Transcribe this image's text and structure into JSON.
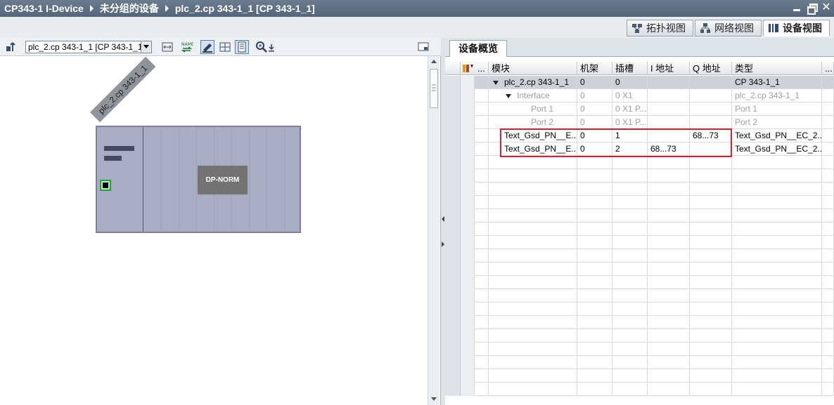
{
  "titlebar": {
    "crumbs": [
      "CP343-1 I-Device",
      "未分组的设备",
      "plc_2.cp 343-1_1 [CP 343-1_1]"
    ]
  },
  "viewtabs": [
    {
      "label": "拓扑视图",
      "icon": "topology-icon"
    },
    {
      "label": "网络视图",
      "icon": "network-icon"
    },
    {
      "label": "设备视图",
      "icon": "device-icon",
      "active": true
    }
  ],
  "toolbar": {
    "device_select": "plc_2.cp 343-1_1 [CP 343-1_1]"
  },
  "canvas": {
    "rail_label": "plc_2.cp 343-1_1",
    "module_label": "DP-NORM"
  },
  "overview": {
    "tab_label": "设备概览",
    "columns": [
      "...",
      "模块",
      "机架",
      "插槽",
      "I 地址",
      "Q 地址",
      "类型",
      "..."
    ],
    "rows": [
      {
        "module": "plc_2.cp 343-1_1",
        "rack": "0",
        "slot": "0",
        "i_addr": "",
        "q_addr": "",
        "type": "CP 343-1_1",
        "gray": false,
        "expand": true,
        "indent": 0
      },
      {
        "module": "Interface",
        "rack": "0",
        "slot": "0 X1",
        "i_addr": "",
        "q_addr": "",
        "type": "plc_2.cp 343-1_1",
        "gray": true,
        "expand": true,
        "indent": 1
      },
      {
        "module": "Port 1",
        "rack": "0",
        "slot": "0 X1 P...",
        "i_addr": "",
        "q_addr": "",
        "type": "Port 1",
        "gray": true,
        "expand": false,
        "indent": 2
      },
      {
        "module": "Port 2",
        "rack": "0",
        "slot": "0 X1 P...",
        "i_addr": "",
        "q_addr": "",
        "type": "Port 2",
        "gray": true,
        "expand": false,
        "indent": 2
      },
      {
        "module": "Text_Gsd_PN__E...",
        "rack": "0",
        "slot": "1",
        "i_addr": "",
        "q_addr": "68...73",
        "type": "Text_Gsd_PN__EC_2...",
        "gray": false,
        "expand": false,
        "indent": 0
      },
      {
        "module": "Text_Gsd_PN__E...",
        "rack": "0",
        "slot": "2",
        "i_addr": "68...73",
        "q_addr": "",
        "type": "Text_Gsd_PN__EC_2...",
        "gray": false,
        "expand": false,
        "indent": 0
      }
    ]
  },
  "colors": {
    "titlebar": "#5f6f80",
    "highlight": "#d4232c",
    "rack": "#a9adc4"
  }
}
